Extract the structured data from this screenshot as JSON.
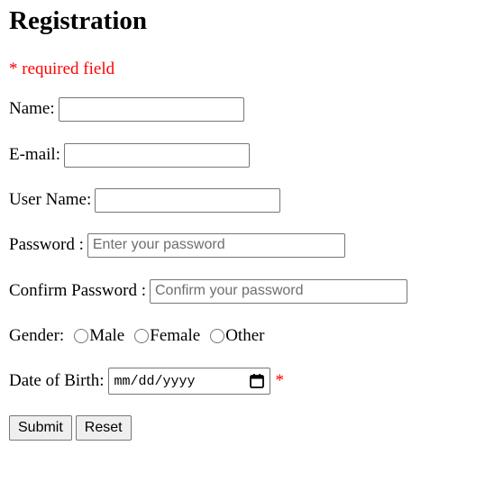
{
  "page": {
    "title": "Registration",
    "required_note": "* required field"
  },
  "form": {
    "name": {
      "label": "Name:",
      "value": "",
      "placeholder": ""
    },
    "email": {
      "label": "E-mail:",
      "value": "",
      "placeholder": ""
    },
    "username": {
      "label": "User Name:",
      "value": "",
      "placeholder": ""
    },
    "password": {
      "label": "Password :",
      "value": "",
      "placeholder": "Enter your password"
    },
    "confirm_password": {
      "label": "Confirm Password :",
      "value": "",
      "placeholder": "Confirm your password"
    },
    "gender": {
      "label": "Gender:",
      "options": [
        "Male",
        "Female",
        "Other"
      ],
      "selected": null
    },
    "dob": {
      "label": "Date of Birth:",
      "value_display": "mm/dd/yyyy",
      "required_marker": "*",
      "icon": "calendar-icon"
    },
    "buttons": {
      "submit": "Submit",
      "reset": "Reset"
    }
  },
  "colors": {
    "required": "#ff0000",
    "button_bg": "#efefef",
    "input_border": "#767676"
  }
}
